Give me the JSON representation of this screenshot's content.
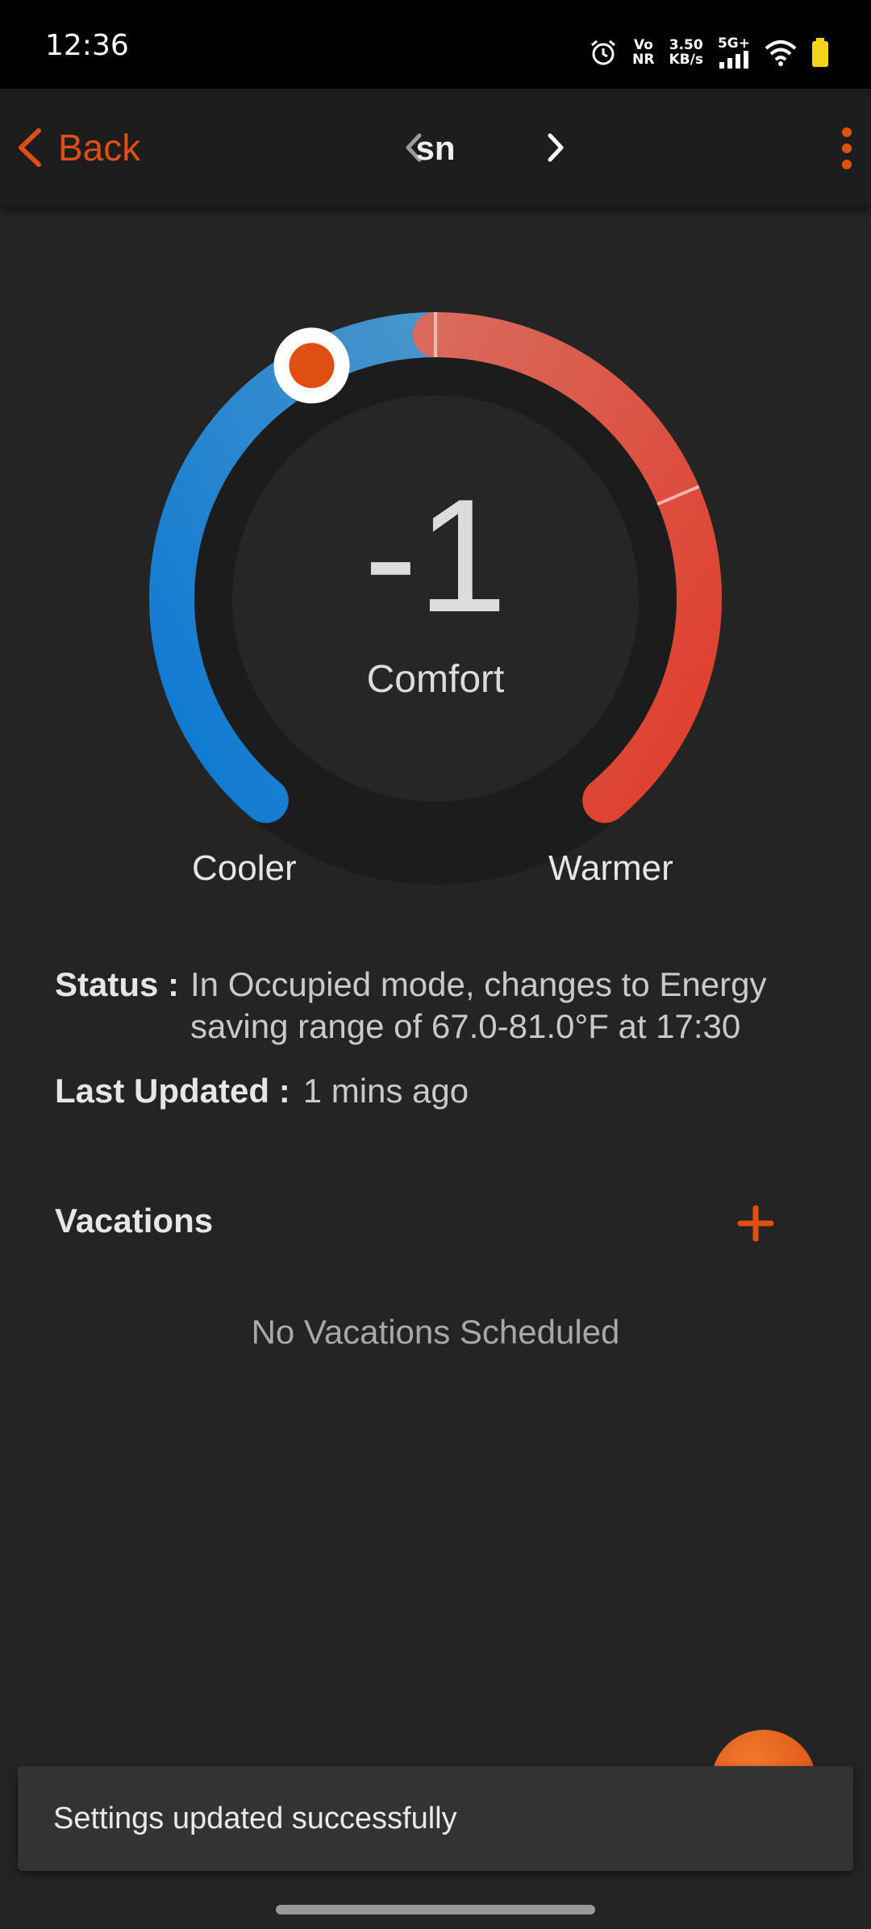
{
  "status_bar": {
    "time": "12:36",
    "volte_top": "Vo",
    "volte_bottom": "NR",
    "speed_value": "3.50",
    "speed_unit": "KB/s",
    "network": "5G+"
  },
  "app_bar": {
    "back_label": "Back",
    "title": "sn"
  },
  "dial": {
    "value": "-1",
    "mode": "Comfort",
    "cooler_label": "Cooler",
    "warmer_label": "Warmer",
    "cool_color": "#1a7fd4",
    "warm_color": "#dc4a35",
    "knob_color": "#e04f12",
    "min": -5,
    "max": 5,
    "current": -1
  },
  "info": {
    "status_label": "Status :",
    "status_text": "In Occupied mode, changes to Energy saving range of 67.0-81.0°F at 17:30",
    "updated_label": "Last Updated :",
    "updated_text": "1 mins ago"
  },
  "vacations": {
    "title": "Vacations",
    "empty_text": "No Vacations Scheduled"
  },
  "toast": {
    "message": "Settings updated successfully"
  },
  "icons": {
    "back": "chevron-left-icon",
    "prev": "chevron-left-icon",
    "next": "chevron-right-icon",
    "menu": "more-vert-icon",
    "add": "plus-icon",
    "fab": "chat-icon"
  },
  "accent_color": "#e04f12"
}
